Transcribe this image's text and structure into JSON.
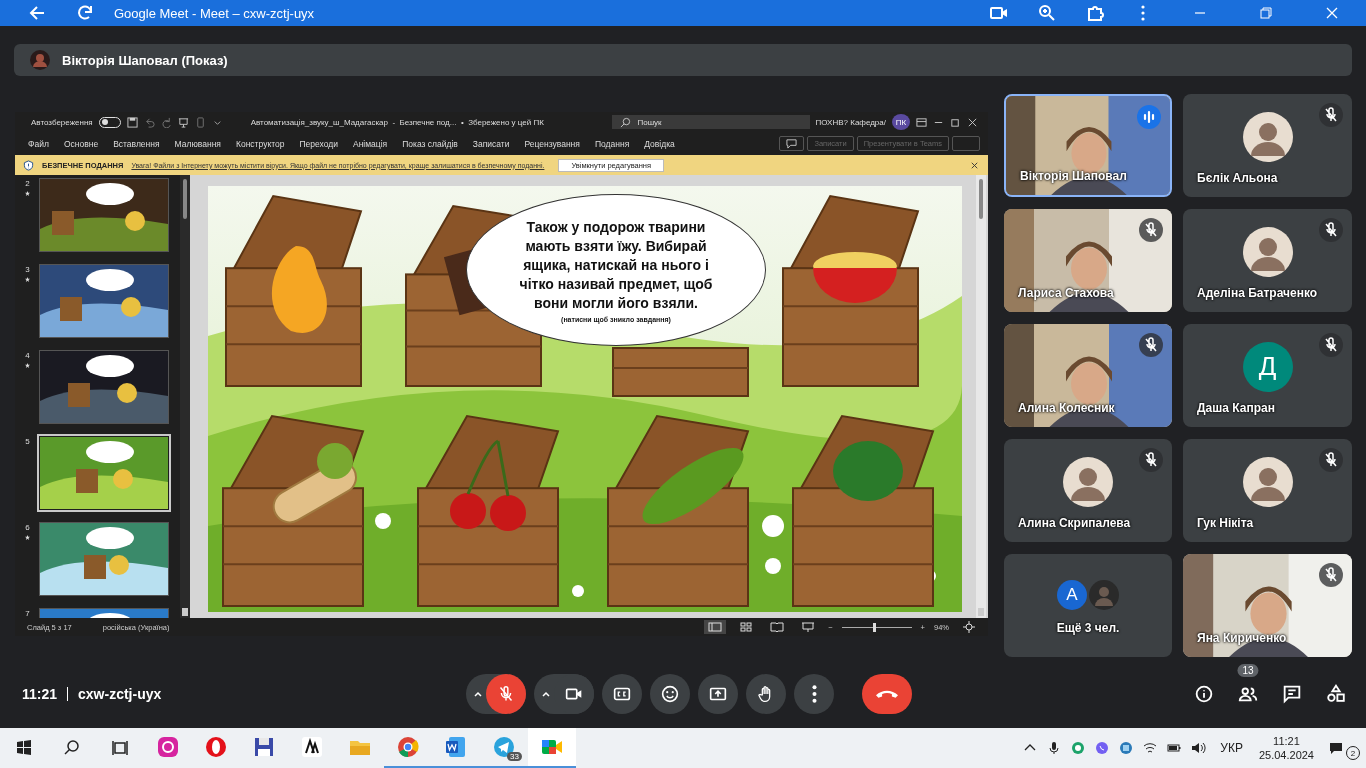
{
  "browser": {
    "title": "Google Meet - Meet – cxw-zctj-uyx"
  },
  "presenter": {
    "label": "Вікторія Шаповал (Показ)"
  },
  "powerpoint": {
    "autosave": {
      "label": "Автозбереження",
      "on": false
    },
    "document_title": "Автоматизація_звуку_ш_Мадагаскар  -  Безпечне под...  •  Збережено у цей ПК",
    "search": {
      "placeholder": "Пошук"
    },
    "account": {
      "name": "ПОХНВ? Кафедра/",
      "initials": "ПК"
    },
    "menu": [
      "Файл",
      "Основне",
      "Вставлення",
      "Малювання",
      "Конструктор",
      "Переходи",
      "Анімація",
      "Показ слайдів",
      "Записати",
      "Рецензування",
      "Подання",
      "Довідка"
    ],
    "ribbon_buttons": [
      {
        "label": "Записати",
        "disabled": true
      },
      {
        "label": "Презентувати в Teams",
        "disabled": true
      }
    ],
    "protected_view": {
      "title": "БЕЗПЕЧНЕ ПОДАННЯ",
      "message": "Увага! Файли з Інтернету можуть містити віруси. Якщо файл не потрібно редагувати, краще залишатися в безпечному поданні.",
      "button": "Увімкнути редагування"
    },
    "slides": [
      {
        "number": "2",
        "starred": true,
        "selected": false
      },
      {
        "number": "3",
        "starred": true,
        "selected": false
      },
      {
        "number": "4",
        "starred": true,
        "selected": false
      },
      {
        "number": "5",
        "starred": false,
        "selected": true
      },
      {
        "number": "6",
        "starred": true,
        "selected": false
      },
      {
        "number": "7",
        "starred": false,
        "selected": false
      }
    ],
    "slide": {
      "bubble_text": "Також у подорож тварини мають взяти їжу. Вибирай ящика, натискай на нього і чітко називай предмет, щоб вони могли його взяли.",
      "bubble_note": "(натисни щоб зникло завдання)"
    },
    "status_bar": {
      "slide_counter": "Слайд 5 з 17",
      "language": "російська (Україна)",
      "zoom_out": "−",
      "zoom_in": "+",
      "zoom": {
        "level": 0.45
      },
      "zoom_label": "94%"
    }
  },
  "participants": [
    {
      "name": "Вікторія Шаповал",
      "kind": "video",
      "muted": false,
      "speaking": true
    },
    {
      "name": "Бєлік Альона",
      "kind": "avatar",
      "muted": true,
      "speaking": false
    },
    {
      "name": "Лариса Стахова",
      "kind": "video",
      "muted": true,
      "speaking": false
    },
    {
      "name": "Аделіна Батраченко",
      "kind": "avatar",
      "muted": true,
      "speaking": false
    },
    {
      "name": "Алина Колесник",
      "kind": "video",
      "muted": true,
      "speaking": false
    },
    {
      "name": "Даша Капран",
      "kind": "letter",
      "initial": "Д",
      "color": "#00897b",
      "muted": true,
      "speaking": false
    },
    {
      "name": "Алина Скрипалева",
      "kind": "avatar",
      "muted": true,
      "speaking": false
    },
    {
      "name": "Гук Нікіта",
      "kind": "avatar",
      "muted": true,
      "speaking": false
    },
    {
      "name": "Ещё 3 чел.",
      "kind": "more",
      "initial": "А",
      "color": "#1967d2",
      "muted": false,
      "speaking": false
    },
    {
      "name": "Яна Кириченко",
      "kind": "video",
      "muted": true,
      "speaking": false
    }
  ],
  "call_bar": {
    "time": "11:21",
    "meeting_code": "cxw-zctj-uyx",
    "controls": [
      {
        "kind": "mic",
        "on": false
      },
      {
        "kind": "camera",
        "on": true
      },
      {
        "kind": "captions"
      },
      {
        "kind": "reactions"
      },
      {
        "kind": "present"
      },
      {
        "kind": "hand"
      },
      {
        "kind": "more"
      },
      {
        "kind": "leave"
      }
    ],
    "side_buttons": [
      {
        "kind": "info"
      },
      {
        "kind": "people",
        "badge": "13"
      },
      {
        "kind": "chat"
      },
      {
        "kind": "activities"
      }
    ]
  },
  "taskbar": {
    "apps": [
      {
        "kind": "instagram",
        "running": false,
        "active": false
      },
      {
        "kind": "opera",
        "running": false,
        "active": false
      },
      {
        "kind": "disk",
        "running": false,
        "active": false
      },
      {
        "kind": "letter",
        "running": false,
        "active": false
      },
      {
        "kind": "folder",
        "running": false,
        "active": false
      },
      {
        "kind": "chrome",
        "running": true,
        "active": false
      },
      {
        "kind": "word",
        "running": true,
        "active": false
      },
      {
        "kind": "telegram",
        "running": true,
        "active": false,
        "badge": "33"
      },
      {
        "kind": "meet",
        "running": true,
        "active": true
      }
    ],
    "language": "УКР",
    "time": "11:21",
    "date": "25.04.2024",
    "notifications": "2"
  }
}
